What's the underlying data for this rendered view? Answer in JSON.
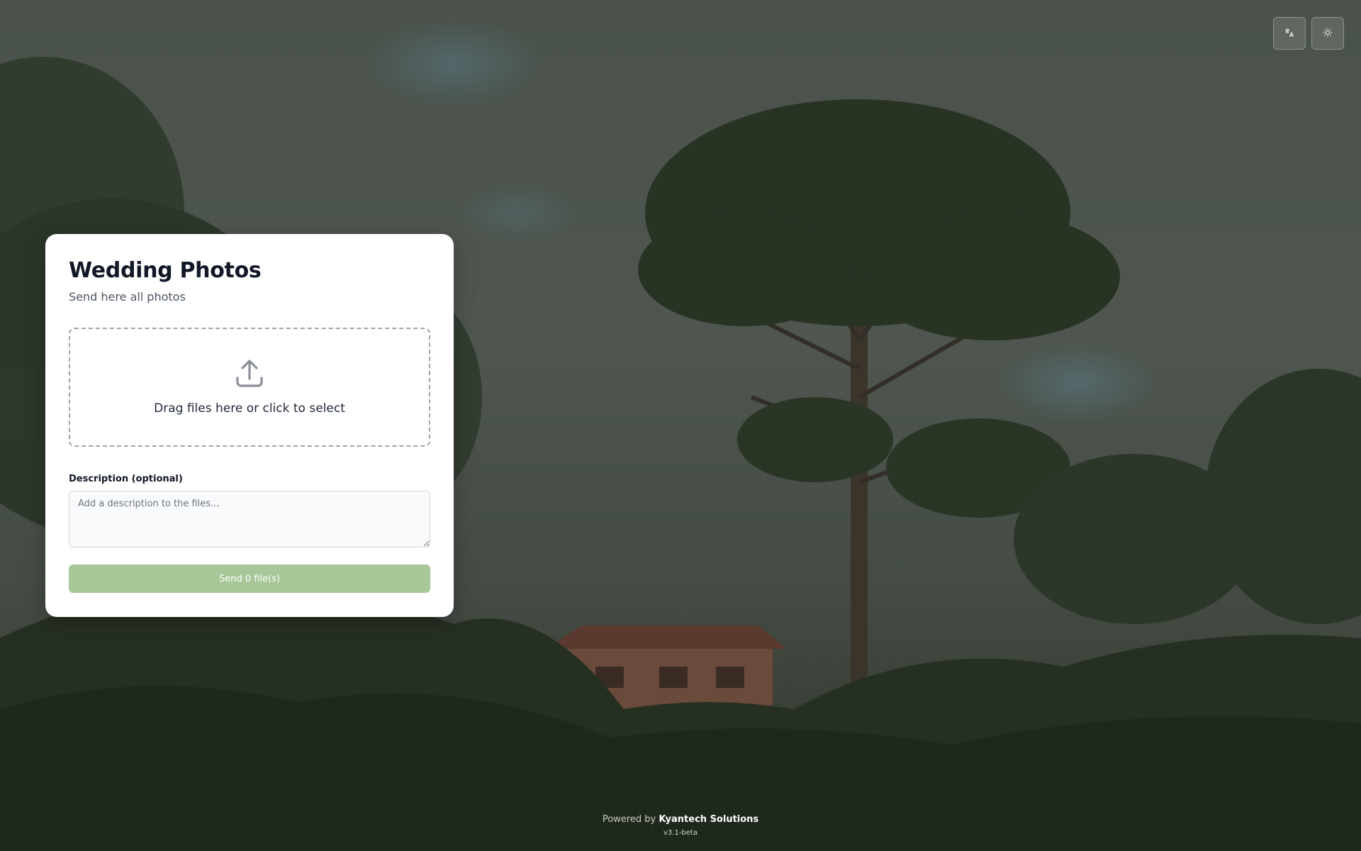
{
  "header": {
    "translate_icon": "translate-icon",
    "theme_icon": "sun-icon"
  },
  "card": {
    "title": "Wedding Photos",
    "subtitle": "Send here all photos",
    "dropzone": {
      "icon": "upload-icon",
      "text": "Drag files here or click to select"
    },
    "description": {
      "label": "Description (optional)",
      "placeholder": "Add a description to the files...",
      "value": ""
    },
    "send_label": "Send 0 file(s)"
  },
  "footer": {
    "powered_by": "Powered by",
    "brand": "Kyantech Solutions",
    "version": "v3.1-beta"
  },
  "colors": {
    "accent": "#a8c798",
    "card_bg": "#ffffff",
    "title": "#111827"
  }
}
